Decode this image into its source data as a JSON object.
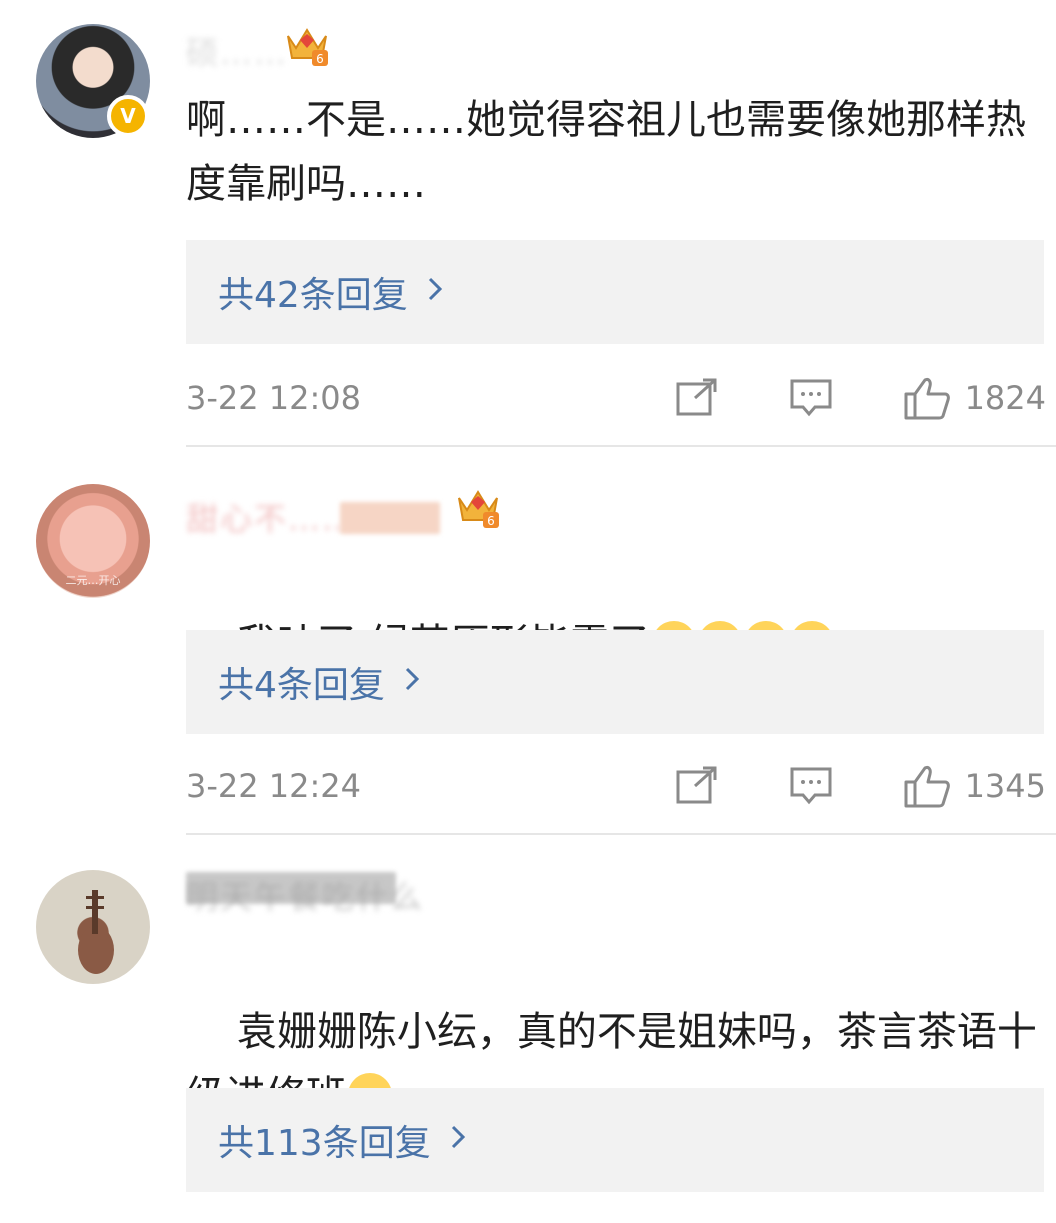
{
  "comments": [
    {
      "username": "硕……",
      "text": "啊……不是……她觉得容祖儿也需要像她那样热度靠刷吗……",
      "replies_label": "共42条回复",
      "time": "3-22 12:08",
      "likes": "1824",
      "verified_badge": "V",
      "crown_level": "6"
    },
    {
      "username": "甜心不……",
      "text": "我吐了 绿茶原形毕露了",
      "emojis": [
        "hug-emoji",
        "hug-emoji",
        "hug-emoji",
        "hug-emoji"
      ],
      "replies_label": "共4条回复",
      "time": "3-22 12:24",
      "likes": "1345",
      "crown_level": "6",
      "avatar_caption": "二元…开心"
    },
    {
      "username": "明天午餐吃什么",
      "text": "袁姗姗陈小纭，真的不是姐妹吗，茶言茶语十级进修班",
      "emojis": [
        "laugh-cry-emoji"
      ],
      "replies_label": "共113条回复"
    }
  ],
  "icons": {
    "share": "share-icon",
    "comment": "comment-icon",
    "like": "thumbs-up-icon",
    "chevron": "chevron-right-icon",
    "crown": "crown-icon"
  },
  "colors": {
    "link": "#4a73a8",
    "reply_bg": "#f2f2f2",
    "meta": "#8a8a8a",
    "text": "#1f1f1f",
    "verified": "#f5b400"
  }
}
